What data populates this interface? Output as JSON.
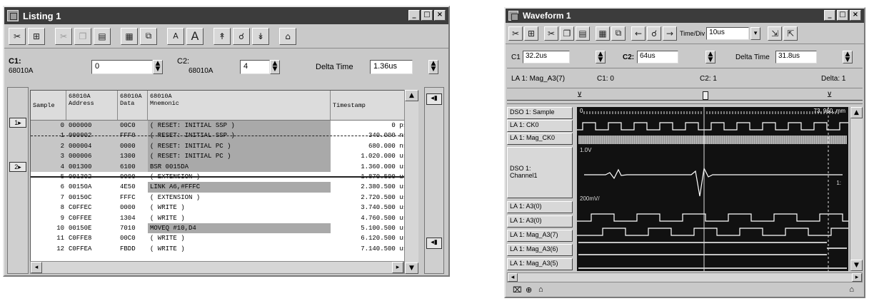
{
  "listing": {
    "title": "Listing 1",
    "c1_label": "C1:",
    "c1_sub": "68010A",
    "c1_value": "0",
    "c2_label": "C2:",
    "c2_sub": "68010A",
    "c2_value": "4",
    "delta_label": "Delta Time",
    "delta_value": "1.36us",
    "columns": [
      "Sample",
      "68010A\nAddress",
      "68010A\nData",
      "68010A\nMnemonic",
      "Timestamp"
    ],
    "rows": [
      {
        "sample": "0",
        "address": "000000",
        "data": "00C0",
        "mnemonic": "( RESET:  INITIAL SSP )",
        "timestamp": "0 ps",
        "shaded": true
      },
      {
        "sample": "1",
        "address": "000002",
        "data": "FFF0",
        "mnemonic": "( RESET:  INITIAL SSP )",
        "timestamp": "340.000 ns",
        "shaded": true
      },
      {
        "sample": "2",
        "address": "000004",
        "data": "0000",
        "mnemonic": "( RESET:  INITIAL PC )",
        "timestamp": "680.000 ns",
        "shaded": true
      },
      {
        "sample": "3",
        "address": "000006",
        "data": "1300",
        "mnemonic": "( RESET:  INITIAL PC )",
        "timestamp": "1.020.000 us",
        "shaded": true
      },
      {
        "sample": "4",
        "address": "001300",
        "data": "6100",
        "mnemonic": "BSR      0015DA",
        "timestamp": "1.360.000 us",
        "shaded": true
      },
      {
        "sample": "5",
        "address": "001302",
        "data": "0000",
        "mnemonic": "( EXTENSION )",
        "timestamp": "1.870.500 us",
        "shaded": false
      },
      {
        "sample": "6",
        "address": "00150A",
        "data": "4E50",
        "mnemonic": "LINK     A6,#FFFC",
        "timestamp": "2.380.500 us",
        "shaded": true
      },
      {
        "sample": "7",
        "address": "00150C",
        "data": "FFFC",
        "mnemonic": "( EXTENSION )",
        "timestamp": "2.720.500 us",
        "shaded": false
      },
      {
        "sample": "8",
        "address": "C0FFEC",
        "data": "0000",
        "mnemonic": "( WRITE )",
        "timestamp": "3.740.500 us",
        "shaded": false
      },
      {
        "sample": "9",
        "address": "C0FFEE",
        "data": "1304",
        "mnemonic": "( WRITE )",
        "timestamp": "4.760.500 us",
        "shaded": false
      },
      {
        "sample": "10",
        "address": "00150E",
        "data": "7010",
        "mnemonic": "MOVEQ    #10,D4",
        "timestamp": "5.100.500 us",
        "shaded": true
      },
      {
        "sample": "11",
        "address": "C0FFE8",
        "data": "00C0",
        "mnemonic": "( WRITE )",
        "timestamp": "6.120.500 us",
        "shaded": false
      },
      {
        "sample": "12",
        "address": "C0FFEA",
        "data": "FBDD",
        "mnemonic": "( WRITE )",
        "timestamp": "7.140.500 us",
        "shaded": false
      }
    ]
  },
  "waveform": {
    "title": "Waveform 1",
    "time_div_label": "Time/Div",
    "time_div_value": "10us",
    "c1_label": "C1",
    "c1_value": "32.2us",
    "c2_label": "C2:",
    "c2_value": "64us",
    "delta_label": "Delta Time",
    "delta_value": "31.8us",
    "status_left": "LA 1: Mag_A3(7)",
    "status_c1": "C1: 0",
    "status_c2": "C2: 1",
    "status_delta": "Delta: 1",
    "sample_start": "0",
    "sample_end": "73, 960, mm",
    "dso_top_label": "1.0V",
    "dso_bottom_label": "200mV/",
    "dso_marker": "1:",
    "labels": [
      "DSO 1: Sample",
      "LA 1: CK0",
      "LA 1: Mag_CK0",
      "DSO 1:\nChannel1",
      "LA 1: A3(0)",
      "LA 1: A3(0)",
      "LA 1: Mag_A3(7)",
      "LA 1: Mag_A3(6)",
      "LA 1: Mag_A3(5)"
    ]
  }
}
